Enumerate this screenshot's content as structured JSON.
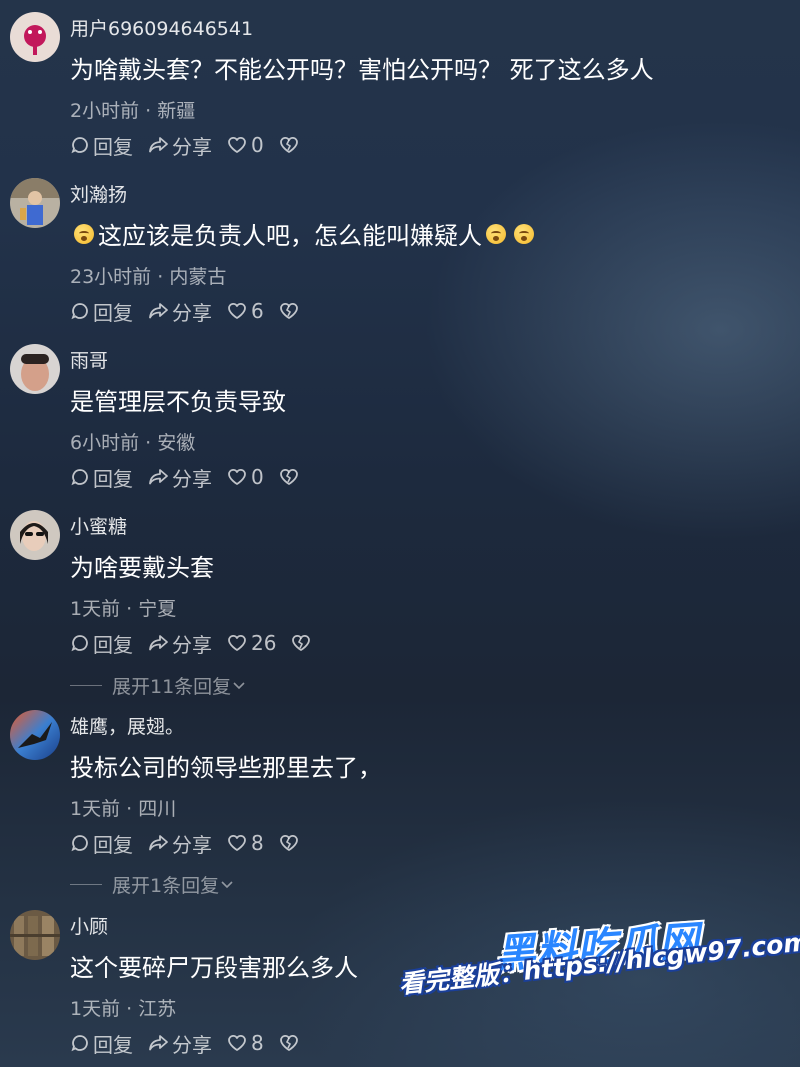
{
  "comments": [
    {
      "username": "用户696094646541",
      "text": "为啥戴头套？不能公开吗？害怕公开吗？ 死了这么多人",
      "time": "2小时前",
      "location": "新疆",
      "reply": "回复",
      "share": "分享",
      "likes": "0"
    },
    {
      "username": "刘瀚扬",
      "text": "这应该是负责人吧，怎么能叫嫌疑人",
      "time": "23小时前",
      "location": "内蒙古",
      "reply": "回复",
      "share": "分享",
      "likes": "6"
    },
    {
      "username": "雨哥",
      "text": "是管理层不负责导致",
      "time": "6小时前",
      "location": "安徽",
      "reply": "回复",
      "share": "分享",
      "likes": "0"
    },
    {
      "username": "小蜜糖",
      "text": "为啥要戴头套",
      "time": "1天前",
      "location": "宁夏",
      "reply": "回复",
      "share": "分享",
      "likes": "26",
      "expand": "展开11条回复"
    },
    {
      "username": "雄鹰，展翅。",
      "text": "投标公司的领导些那里去了，",
      "time": "1天前",
      "location": "四川",
      "reply": "回复",
      "share": "分享",
      "likes": "8",
      "expand": "展开1条回复"
    },
    {
      "username": "小顾",
      "text": "这个要碎尸万段害那么多人",
      "time": "1天前",
      "location": "江苏",
      "reply": "回复",
      "share": "分享",
      "likes": "8"
    }
  ],
  "separator": "·",
  "watermark": {
    "title": "黑料吃瓜网",
    "url": "看完整版：https://hlcgw97.com"
  },
  "colors": {
    "accent": "#2a86ff",
    "background": "#1f2c40"
  }
}
